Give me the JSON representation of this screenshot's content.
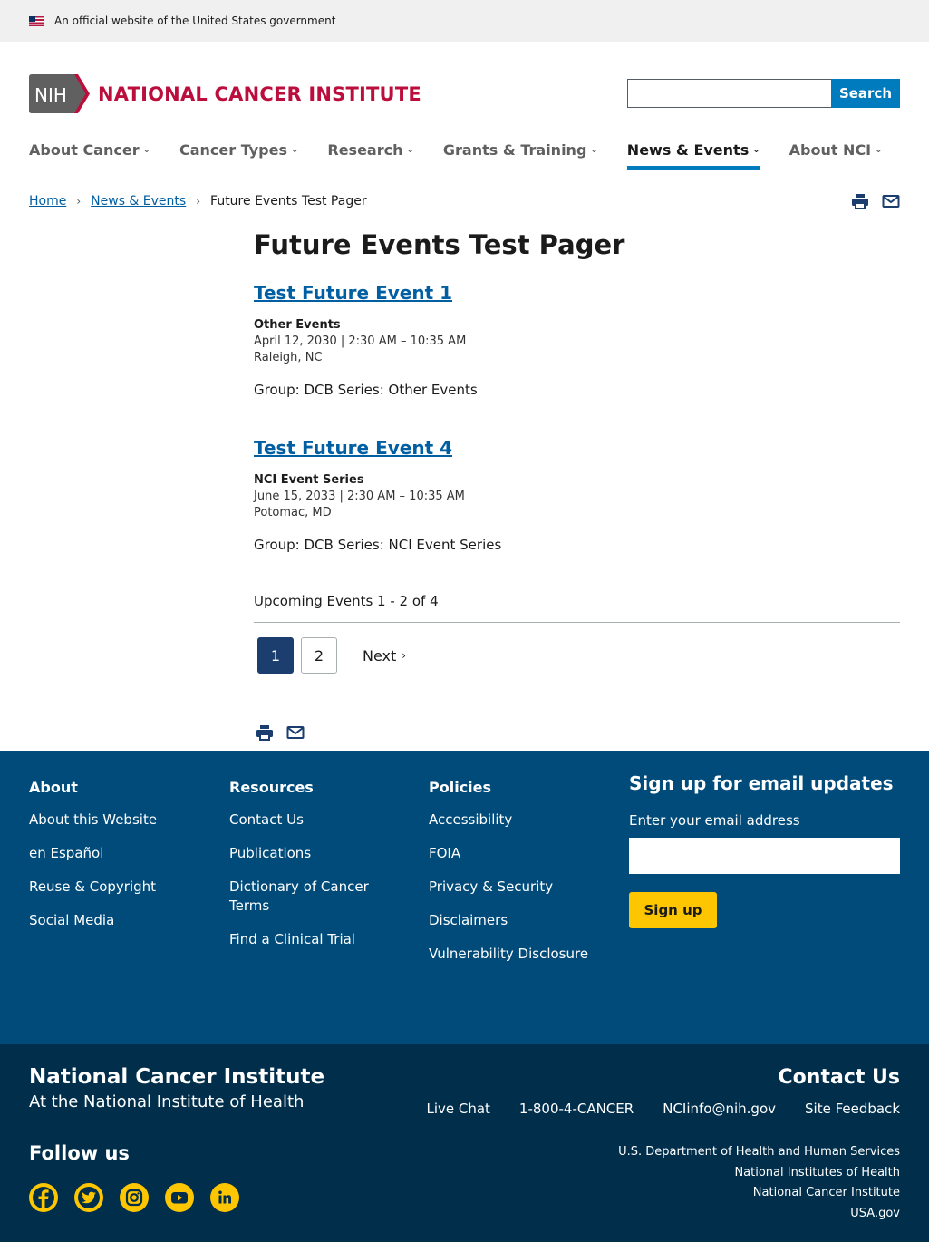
{
  "gov_banner": {
    "text": "An official website of the United States government"
  },
  "header": {
    "logo_nih": "NIH",
    "logo_text": "NATIONAL CANCER INSTITUTE",
    "search_placeholder": "",
    "search_button": "Search"
  },
  "nav": {
    "items": [
      {
        "label": "About Cancer"
      },
      {
        "label": "Cancer Types"
      },
      {
        "label": "Research"
      },
      {
        "label": "Grants & Training"
      },
      {
        "label": "News & Events",
        "active": true
      },
      {
        "label": "About NCI"
      }
    ]
  },
  "breadcrumb": {
    "home": "Home",
    "news": "News & Events",
    "current": "Future Events Test Pager"
  },
  "main": {
    "title": "Future Events Test Pager",
    "events": [
      {
        "title": "Test Future Event 1",
        "series": "Other Events",
        "datetime": "April 12, 2030 | 2:30 AM – 10:35 AM",
        "location": "Raleigh, NC",
        "group": "Group: DCB Series: Other Events"
      },
      {
        "title": "Test Future Event 4",
        "series": "NCI Event Series",
        "datetime": "June 15, 2033 | 2:30 AM – 10:35 AM",
        "location": "Potomac, MD",
        "group": "Group: DCB Series: NCI Event Series"
      }
    ],
    "pager_summary": "Upcoming Events 1 - 2 of 4",
    "pager": {
      "page1": "1",
      "page2": "2",
      "next": "Next"
    }
  },
  "footer": {
    "about": {
      "heading": "About",
      "links": [
        "About this Website",
        "en Español",
        "Reuse & Copyright",
        "Social Media"
      ]
    },
    "resources": {
      "heading": "Resources",
      "links": [
        "Contact Us",
        "Publications",
        "Dictionary of Cancer Terms",
        "Find a Clinical Trial"
      ]
    },
    "policies": {
      "heading": "Policies",
      "links": [
        "Accessibility",
        "FOIA",
        "Privacy & Security",
        "Disclaimers",
        "Vulnerability Disclosure"
      ]
    },
    "signup": {
      "heading": "Sign up for email updates",
      "label": "Enter your email address",
      "button": "Sign up"
    },
    "org_name": "National Cancer Institute",
    "org_sub": "At the National Institute of Health",
    "follow": "Follow us",
    "socials": [
      "facebook-icon",
      "twitter-icon",
      "instagram-icon",
      "youtube-icon",
      "linkedin-icon"
    ],
    "contact_title": "Contact Us",
    "contact_links": [
      "Live Chat",
      "1-800-4-CANCER",
      "NCIinfo@nih.gov",
      "Site Feedback"
    ],
    "agencies": [
      "U.S. Department of Health and Human Services",
      "National Institutes of Health",
      "National Cancer Institute",
      "USA.gov"
    ]
  },
  "colors": {
    "brand_red": "#bb0e3d",
    "link_blue": "#005ea2",
    "accent_blue": "#007bbd",
    "footer_blue": "#004b7a",
    "footer_dark": "#002e4b",
    "yellow": "#fdc600",
    "pager_active": "#1b3e6f"
  }
}
